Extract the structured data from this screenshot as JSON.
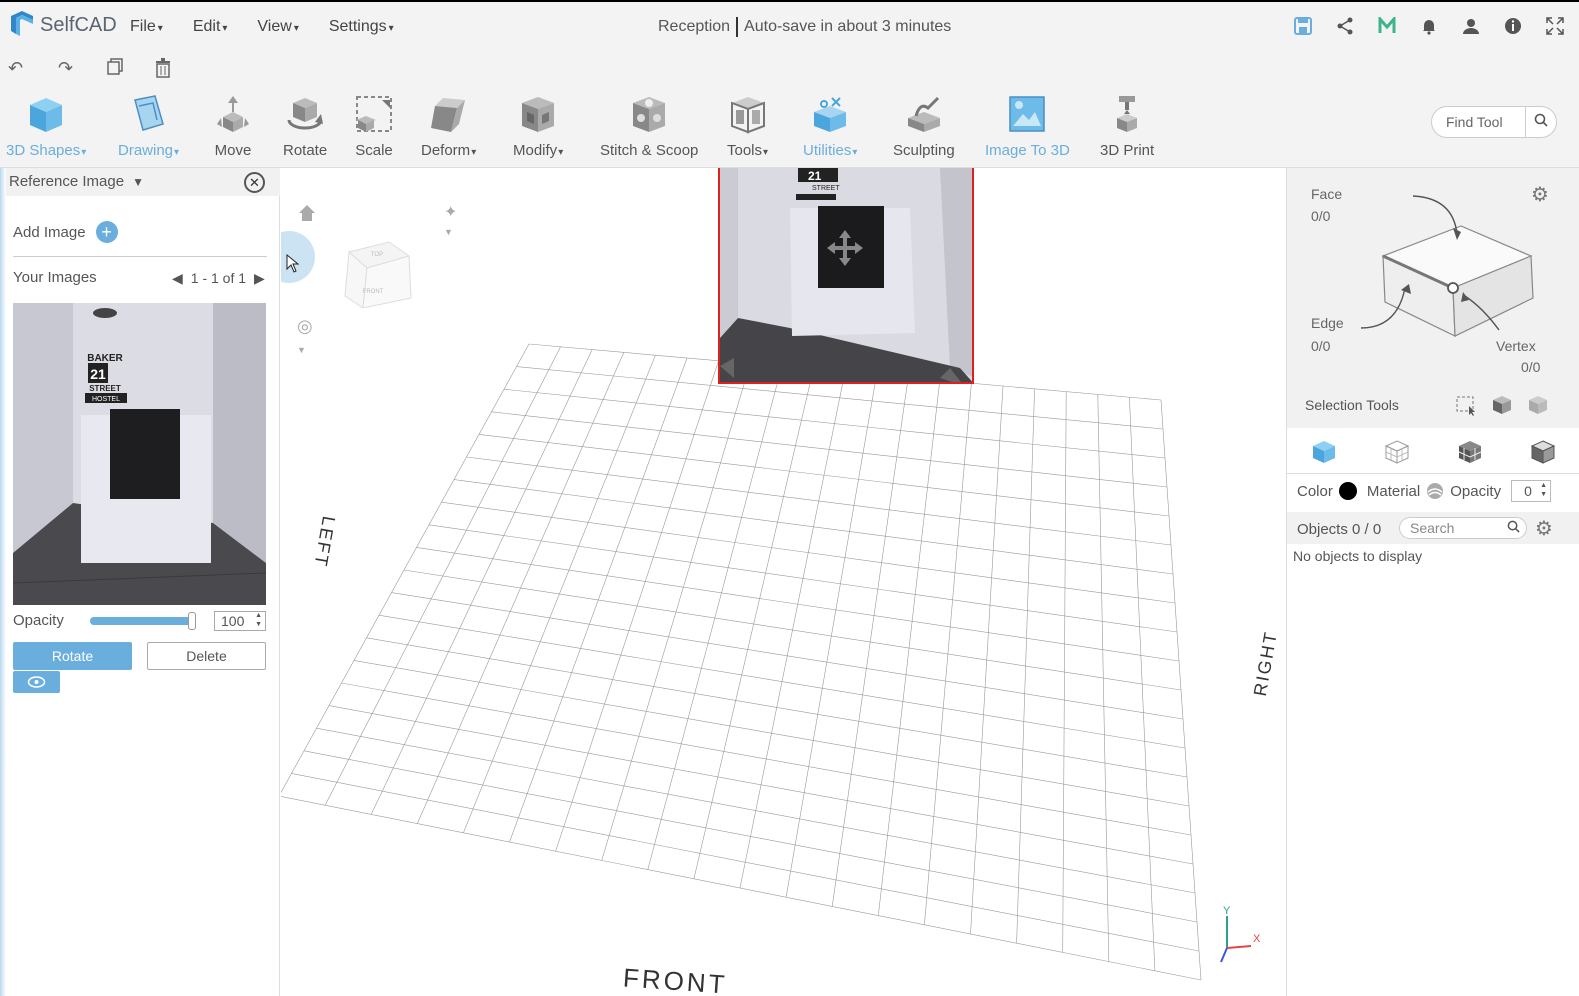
{
  "app": {
    "name": "SelfCAD",
    "menus": [
      "File",
      "Edit",
      "View",
      "Settings"
    ],
    "doc_title": "Reception",
    "autosave": "Auto-save in about 3 minutes",
    "accent_color": "#6aaede"
  },
  "toolbar": {
    "tools": [
      {
        "label": "3D Shapes",
        "blue": true,
        "dropdown": true,
        "icon": "cube-icon"
      },
      {
        "label": "Drawing",
        "blue": true,
        "dropdown": true,
        "icon": "drawing-icon"
      },
      {
        "label": "Move",
        "blue": false,
        "dropdown": false,
        "icon": "move-icon"
      },
      {
        "label": "Rotate",
        "blue": false,
        "dropdown": false,
        "icon": "rotate-icon"
      },
      {
        "label": "Scale",
        "blue": false,
        "dropdown": false,
        "icon": "scale-icon"
      },
      {
        "label": "Deform",
        "blue": false,
        "dropdown": true,
        "icon": "deform-icon"
      },
      {
        "label": "Modify",
        "blue": false,
        "dropdown": true,
        "icon": "modify-icon"
      },
      {
        "label": "Stitch & Scoop",
        "blue": false,
        "dropdown": false,
        "icon": "stitch-scoop-icon"
      },
      {
        "label": "Tools",
        "blue": false,
        "dropdown": true,
        "icon": "tools-icon"
      },
      {
        "label": "Utilities",
        "blue": true,
        "dropdown": true,
        "icon": "utilities-icon"
      },
      {
        "label": "Sculpting",
        "blue": false,
        "dropdown": false,
        "icon": "sculpting-icon"
      },
      {
        "label": "Image To 3D",
        "blue": true,
        "dropdown": false,
        "icon": "image-to-3d-icon"
      },
      {
        "label": "3D Print",
        "blue": false,
        "dropdown": false,
        "icon": "print-icon"
      }
    ],
    "find_tool_placeholder": "Find Tool"
  },
  "left_panel": {
    "header": "Reference Image",
    "add_image": "Add Image",
    "your_images": "Your Images",
    "pager": "1 - 1 of 1",
    "opacity_label": "Opacity",
    "opacity_value": "100",
    "rotate_button": "Rotate",
    "delete_button": "Delete",
    "thumb_sign": {
      "line1": "BAKER",
      "num": "21",
      "line2": "STREET",
      "line3": "HOSTEL"
    }
  },
  "viewport": {
    "labels": {
      "left": "LEFT",
      "right": "RIGHT",
      "front": "FRONT"
    },
    "navcube": {
      "top": "TOP",
      "front": "FRONT"
    },
    "axes": {
      "x": "X",
      "y": "Y"
    }
  },
  "right_panel": {
    "face_label": "Face",
    "face_value": "0/0",
    "edge_label": "Edge",
    "edge_value": "0/0",
    "vertex_label": "Vertex",
    "vertex_value": "0/0",
    "selection_tools": "Selection Tools",
    "color_label": "Color",
    "material_label": "Material",
    "opacity_label": "Opacity",
    "opacity_value": "0",
    "objects_label": "Objects 0 / 0",
    "search_placeholder": "Search",
    "no_objects": "No objects to display"
  }
}
